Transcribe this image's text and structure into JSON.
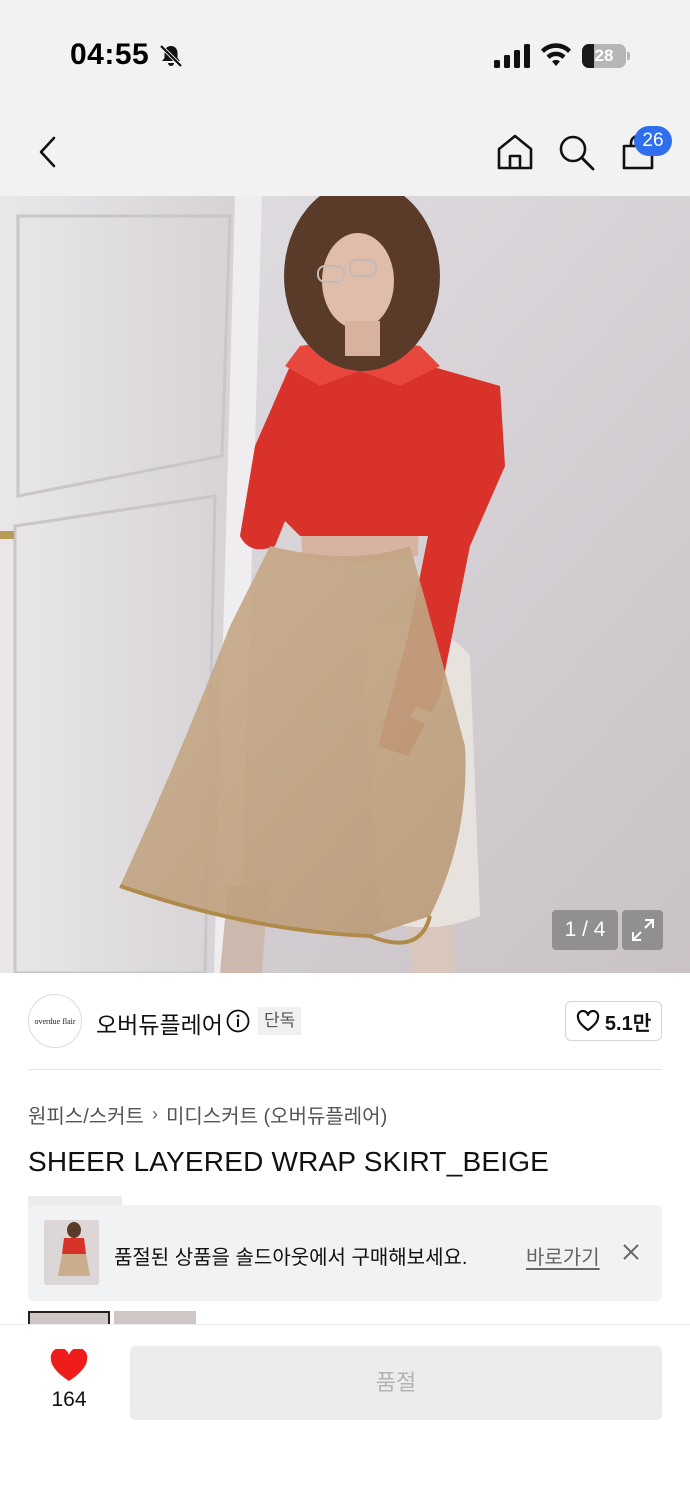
{
  "status_bar": {
    "time": "04:55",
    "battery": "28",
    "battery_level": 0.28
  },
  "nav": {
    "cart_count": "26"
  },
  "gallery": {
    "counter": "1 / 4"
  },
  "brand": {
    "logo_text": "overdue flair",
    "name": "오버듀플레어",
    "tag": "단독",
    "likes": "5.1만"
  },
  "product": {
    "breadcrumb": [
      "원피스/스커트",
      "미디스커트 (오버듀플레어)"
    ],
    "title": "SHEER LAYERED WRAP SKIRT_BEIGE"
  },
  "soldout_banner": {
    "message": "품절된 상품을 솔드아웃에서 구매해보세요.",
    "link_label": "바로가기"
  },
  "bottom": {
    "wish_count": "164",
    "buy_label": "품절"
  },
  "colors": {
    "accent_badge": "#2f6fed",
    "heart": "#ef1c1c",
    "disabled_button": "#ececec"
  },
  "icons": [
    "bell-off-icon",
    "signal-icon",
    "wifi-icon",
    "battery-icon",
    "back-arrow-icon",
    "home-icon",
    "search-icon",
    "cart-icon",
    "expand-icon",
    "info-icon",
    "heart-outline-icon",
    "close-icon",
    "heart-filled-icon"
  ]
}
